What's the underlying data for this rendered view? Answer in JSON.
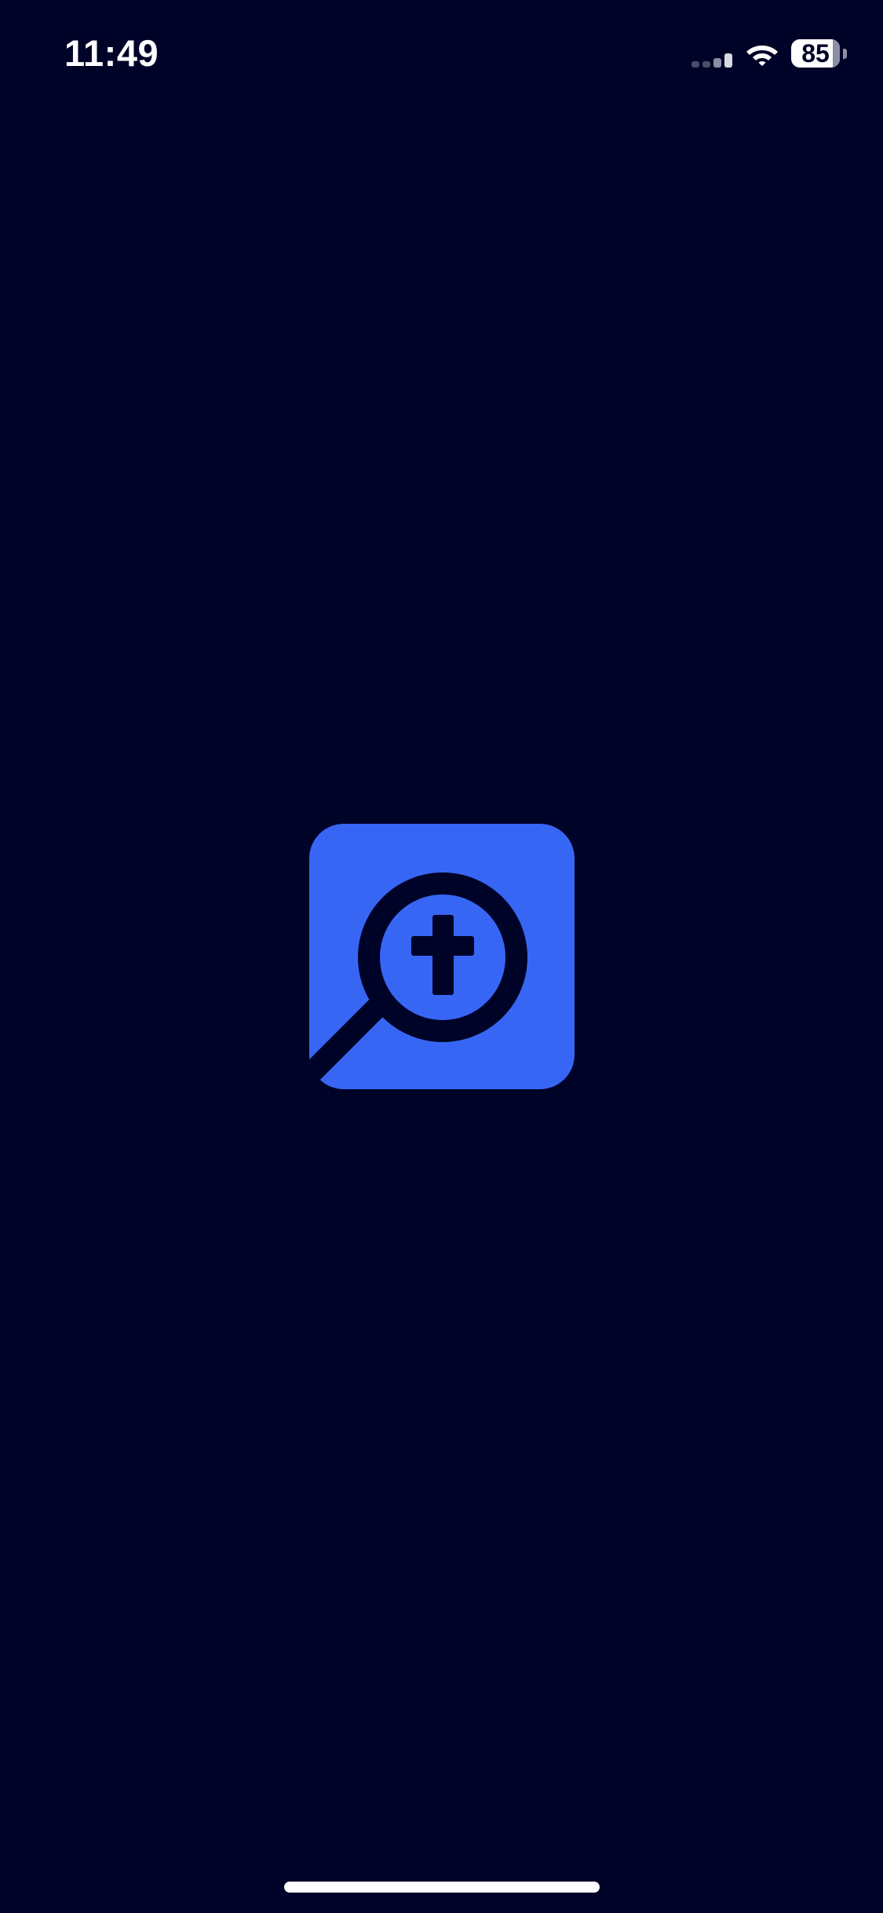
{
  "status_bar": {
    "time": "11:49",
    "battery_level": "85",
    "battery_percent": 85,
    "signal_icon": "cellular-signal-icon",
    "wifi_icon": "wifi-icon"
  },
  "splash": {
    "logo_icon": "magnifying-glass-cross-icon"
  },
  "colors": {
    "background": "#000328",
    "logo_blue": "#3866F4",
    "text": "#FFFFFF"
  }
}
